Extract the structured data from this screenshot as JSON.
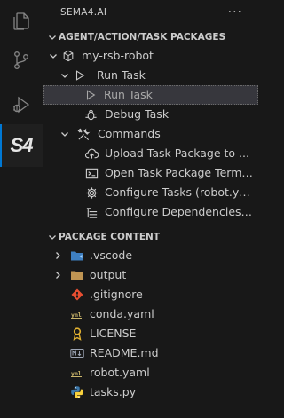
{
  "activity_bar": {
    "items": [
      {
        "name": "explorer-icon"
      },
      {
        "name": "source-control-icon"
      },
      {
        "name": "run-debug-icon"
      },
      {
        "name": "sema4-icon",
        "label": "S4"
      }
    ]
  },
  "sidebar": {
    "title": "SEMA4.AI",
    "more": "···"
  },
  "packages": {
    "header": "AGENT/ACTION/TASK PACKAGES",
    "robot": "my-rsb-robot",
    "run_task_group": "Run Task",
    "run_task_item": "Run Task",
    "debug_task": "Debug Task",
    "commands": "Commands",
    "cmd_upload": "Upload Task Package to ...",
    "cmd_terminal": "Open Task Package Termi...",
    "cmd_configure_tasks": "Configure Tasks (robot.ya...",
    "cmd_configure_deps": "Configure Dependencies ..."
  },
  "content": {
    "header": "PACKAGE CONTENT",
    "items": [
      {
        "label": ".vscode",
        "icon": "vscode-folder-icon"
      },
      {
        "label": "output",
        "icon": "folder-icon"
      },
      {
        "label": ".gitignore",
        "icon": "git-icon"
      },
      {
        "label": "conda.yaml",
        "icon": "yaml-icon"
      },
      {
        "label": "LICENSE",
        "icon": "license-icon"
      },
      {
        "label": "README.md",
        "icon": "markdown-icon"
      },
      {
        "label": "robot.yaml",
        "icon": "yaml-icon"
      },
      {
        "label": "tasks.py",
        "icon": "python-icon"
      }
    ]
  },
  "colors": {
    "accent": "#0078d4",
    "background": "#181818",
    "selection": "#37373d"
  }
}
